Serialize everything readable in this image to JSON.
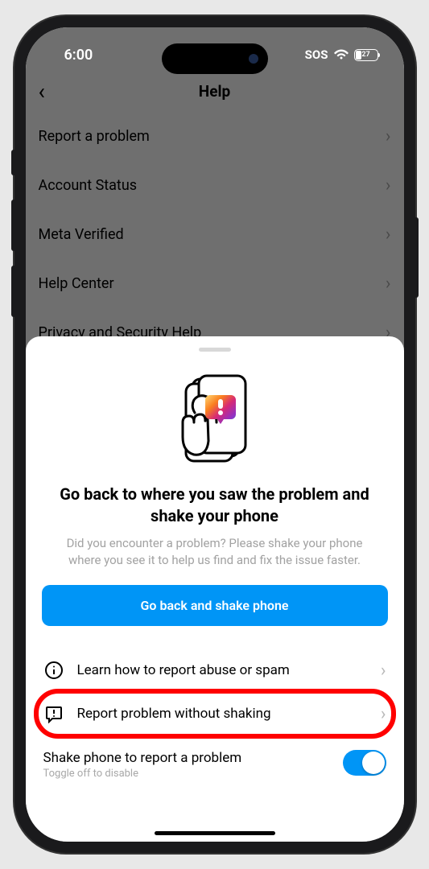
{
  "status": {
    "time": "6:00",
    "sos": "SOS",
    "battery_pct": "27"
  },
  "header": {
    "title": "Help"
  },
  "bg_items": [
    "Report a problem",
    "Account Status",
    "Meta Verified",
    "Help Center",
    "Privacy and Security Help"
  ],
  "sheet": {
    "title": "Go back to where you saw the problem and shake your phone",
    "subtitle": "Did you encounter a problem? Please shake your phone where you see it to help us find and fix the issue faster.",
    "primary_button": "Go back and shake phone",
    "options": [
      {
        "label": "Learn how to report abuse or spam",
        "icon": "info"
      },
      {
        "label": "Report problem without shaking",
        "icon": "alert",
        "highlighted": true
      }
    ],
    "toggle": {
      "title": "Shake phone to report a problem",
      "subtitle": "Toggle off to disable",
      "on": true
    }
  }
}
